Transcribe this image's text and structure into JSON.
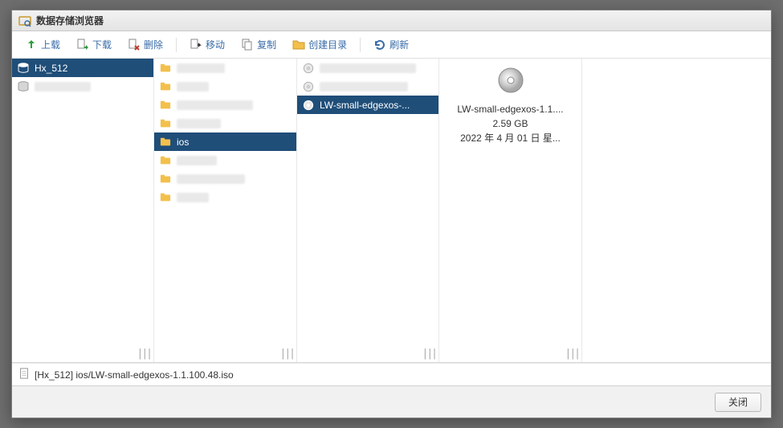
{
  "window": {
    "title": "数据存储浏览器"
  },
  "toolbar": {
    "upload": "上载",
    "download": "下载",
    "delete": "删除",
    "move": "移动",
    "copy": "复制",
    "create_dir": "创建目录",
    "refresh": "刷新"
  },
  "col1": {
    "items": [
      {
        "label": "Hx_512",
        "selected": true,
        "icon": "disk"
      },
      {
        "label": "",
        "selected": false,
        "icon": "disk",
        "redacted": true
      }
    ]
  },
  "col2": {
    "items": [
      {
        "redacted": true,
        "icon": "folder"
      },
      {
        "redacted": true,
        "icon": "folder"
      },
      {
        "redacted": true,
        "icon": "folder"
      },
      {
        "redacted": true,
        "icon": "folder"
      },
      {
        "label": "ios",
        "selected": true,
        "icon": "folder"
      },
      {
        "redacted": true,
        "icon": "folder"
      },
      {
        "redacted": true,
        "icon": "folder"
      },
      {
        "redacted": true,
        "icon": "folder"
      }
    ]
  },
  "col3": {
    "items": [
      {
        "redacted": true,
        "icon": "disc"
      },
      {
        "redacted": true,
        "icon": "disc"
      },
      {
        "label": "LW-small-edgexos-...",
        "selected": true,
        "icon": "disc"
      }
    ]
  },
  "preview": {
    "name": "LW-small-edgexos-1.1....",
    "size": "2.59 GB",
    "date": "2022 年 4 月 01 日 星..."
  },
  "pathbar": {
    "path": "[Hx_512] ios/LW-small-edgexos-1.1.100.48.iso"
  },
  "footer": {
    "close": "关闭"
  }
}
